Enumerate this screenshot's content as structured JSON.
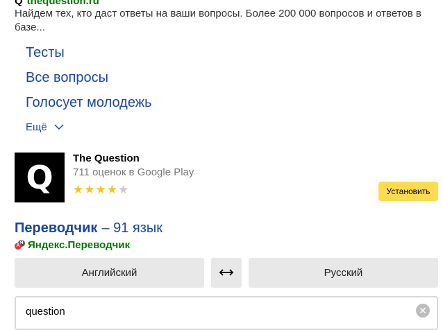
{
  "result": {
    "site_label": "thequestion.ru",
    "snippet": "Найдем тех, кто даст ответы на ваши вопросы. Более 200 000 вопросов и ответов в базе...",
    "sitelinks": [
      "Тесты",
      "Все вопросы",
      "Голосует молодежь"
    ],
    "more_label": "Ещё"
  },
  "app": {
    "icon_letter": "Q",
    "name": "The Question",
    "ratings_count": "711 оценок в Google Play",
    "rating_value": 4,
    "rating_max": 5,
    "install_label": "Установить"
  },
  "translator": {
    "title_main": "Переводчик",
    "title_rest": "– 91 язык",
    "source_label": "Яндекс.Переводчик",
    "icon_letter_a": "A",
    "icon_letter_b": "Я",
    "from_lang": "Английский",
    "to_lang": "Русский",
    "input_value": "question"
  },
  "colors": {
    "link": "#1a46a8",
    "url_green": "#007700",
    "install_yellow": "#ffdb4d",
    "star": "#f5c518"
  }
}
